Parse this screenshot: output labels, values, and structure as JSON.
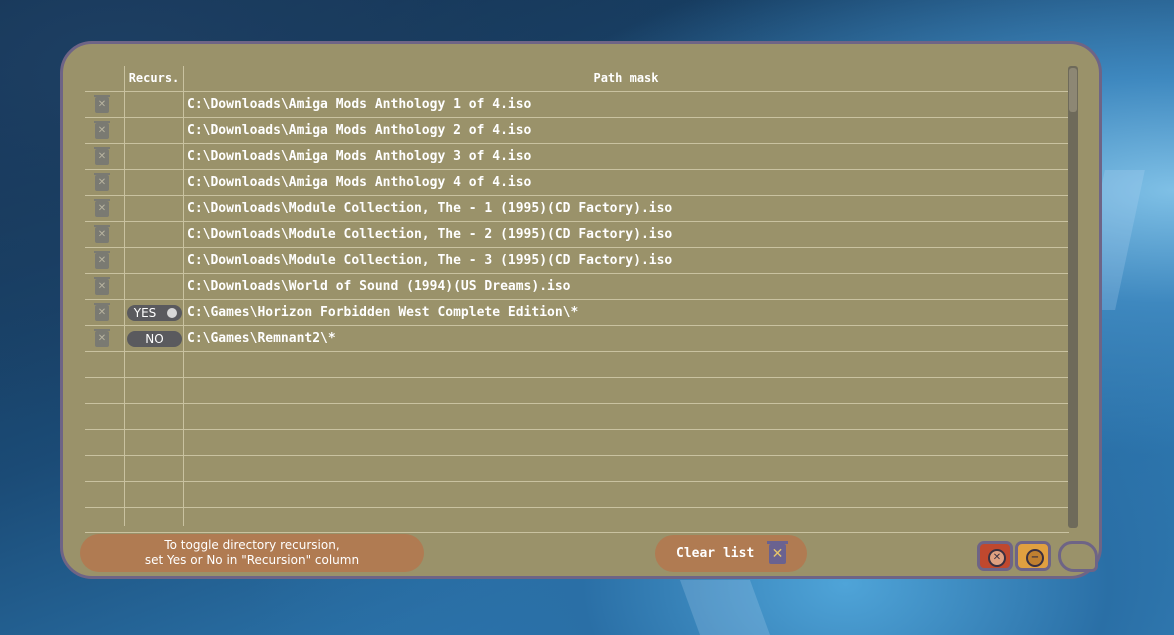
{
  "table": {
    "col_recursion_label": "Recurs.",
    "col_path_label": "Path mask",
    "rows": [
      {
        "path": "C:\\Downloads\\Amiga Mods Anthology 1 of 4.iso",
        "recursion": ""
      },
      {
        "path": "C:\\Downloads\\Amiga Mods Anthology 2 of 4.iso",
        "recursion": ""
      },
      {
        "path": "C:\\Downloads\\Amiga Mods Anthology 3 of 4.iso",
        "recursion": ""
      },
      {
        "path": "C:\\Downloads\\Amiga Mods Anthology 4 of 4.iso",
        "recursion": ""
      },
      {
        "path": "C:\\Downloads\\Module Collection, The - 1 (1995)(CD Factory).iso",
        "recursion": ""
      },
      {
        "path": "C:\\Downloads\\Module Collection, The - 2 (1995)(CD Factory).iso",
        "recursion": ""
      },
      {
        "path": "C:\\Downloads\\Module Collection, The - 3 (1995)(CD Factory).iso",
        "recursion": ""
      },
      {
        "path": "C:\\Downloads\\World of Sound (1994)(US Dreams).iso",
        "recursion": ""
      },
      {
        "path": "C:\\Games\\Horizon Forbidden West Complete Edition\\*",
        "recursion": "YES"
      },
      {
        "path": "C:\\Games\\Remnant2\\*",
        "recursion": "NO"
      }
    ],
    "empty_row_count": 7
  },
  "hint": {
    "line1": "To toggle directory recursion,",
    "line2": "set Yes or No in \"Recursion\" column"
  },
  "clear_button": {
    "label": "Clear list"
  },
  "icons": {
    "delete_row": "trash-x-icon",
    "clear_list": "trash-x-icon",
    "close": "close-circle-icon",
    "minimize": "minus-circle-icon"
  },
  "colors": {
    "panel_bg": "#9a926a",
    "panel_border": "#6e6486",
    "button_bg": "#b07b52",
    "close_button": "#c0482e",
    "minimize_button": "#e0a040",
    "toggle_bg": "#5a5a5e"
  }
}
